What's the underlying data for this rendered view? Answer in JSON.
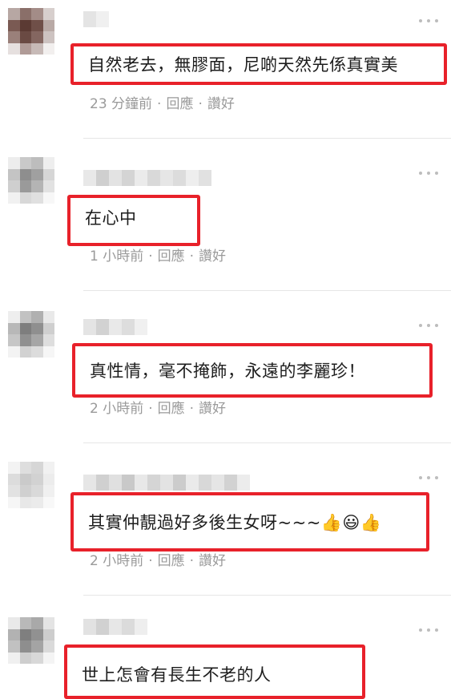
{
  "colors": {
    "highlight_border": "#e8212a",
    "meta_text": "#9a9a9a",
    "divider": "#e6e6e6"
  },
  "more_icon": "ellipsis-icon",
  "comments": [
    {
      "text": "自然老去，無膠面，尼啲天然先係真實美",
      "time": "23 分鐘前",
      "sep": ".",
      "reply": "回應",
      "like": "讚好"
    },
    {
      "text": "在心中",
      "time": "1 小時前",
      "sep": ".",
      "reply": "回應",
      "like": "讚好"
    },
    {
      "text": "真性情，毫不掩飾，永遠的李麗珍！",
      "time": "2 小時前",
      "sep": ".",
      "reply": "回應",
      "like": "讚好"
    },
    {
      "text": "其實仲靚過好多後生女呀~~~👍😃👍",
      "time": "2 小時前",
      "sep": ".",
      "reply": "回應",
      "like": "讚好"
    },
    {
      "text": "世上怎會有長生不老的人"
    }
  ]
}
